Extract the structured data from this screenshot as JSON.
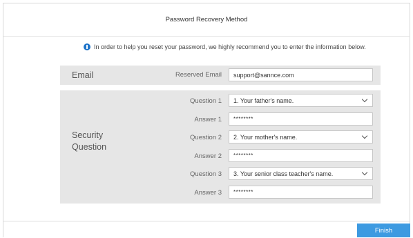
{
  "dialog": {
    "title": "Password Recovery Method",
    "info_text": "In order to help you reset your password, we highly recommend you to enter the information below."
  },
  "email_section": {
    "label": "Email",
    "field_label": "Reserved Email",
    "value": "support@sannce.com"
  },
  "security_section": {
    "label_line1": "Security",
    "label_line2": "Question",
    "rows": [
      {
        "label": "Question 1",
        "value": "1. Your father's name.",
        "type": "select"
      },
      {
        "label": "Answer 1",
        "value": "********",
        "type": "password"
      },
      {
        "label": "Question 2",
        "value": "2. Your mother's name.",
        "type": "select"
      },
      {
        "label": "Answer 2",
        "value": "********",
        "type": "password"
      },
      {
        "label": "Question 3",
        "value": "3. Your senior class teacher's name.",
        "type": "select"
      },
      {
        "label": "Answer 3",
        "value": "********",
        "type": "password"
      }
    ]
  },
  "footer": {
    "finish_label": "Finish"
  },
  "colors": {
    "accent": "#3d9ae1",
    "info_icon": "#1f74c9",
    "panel_bg": "#e6e6e6"
  }
}
